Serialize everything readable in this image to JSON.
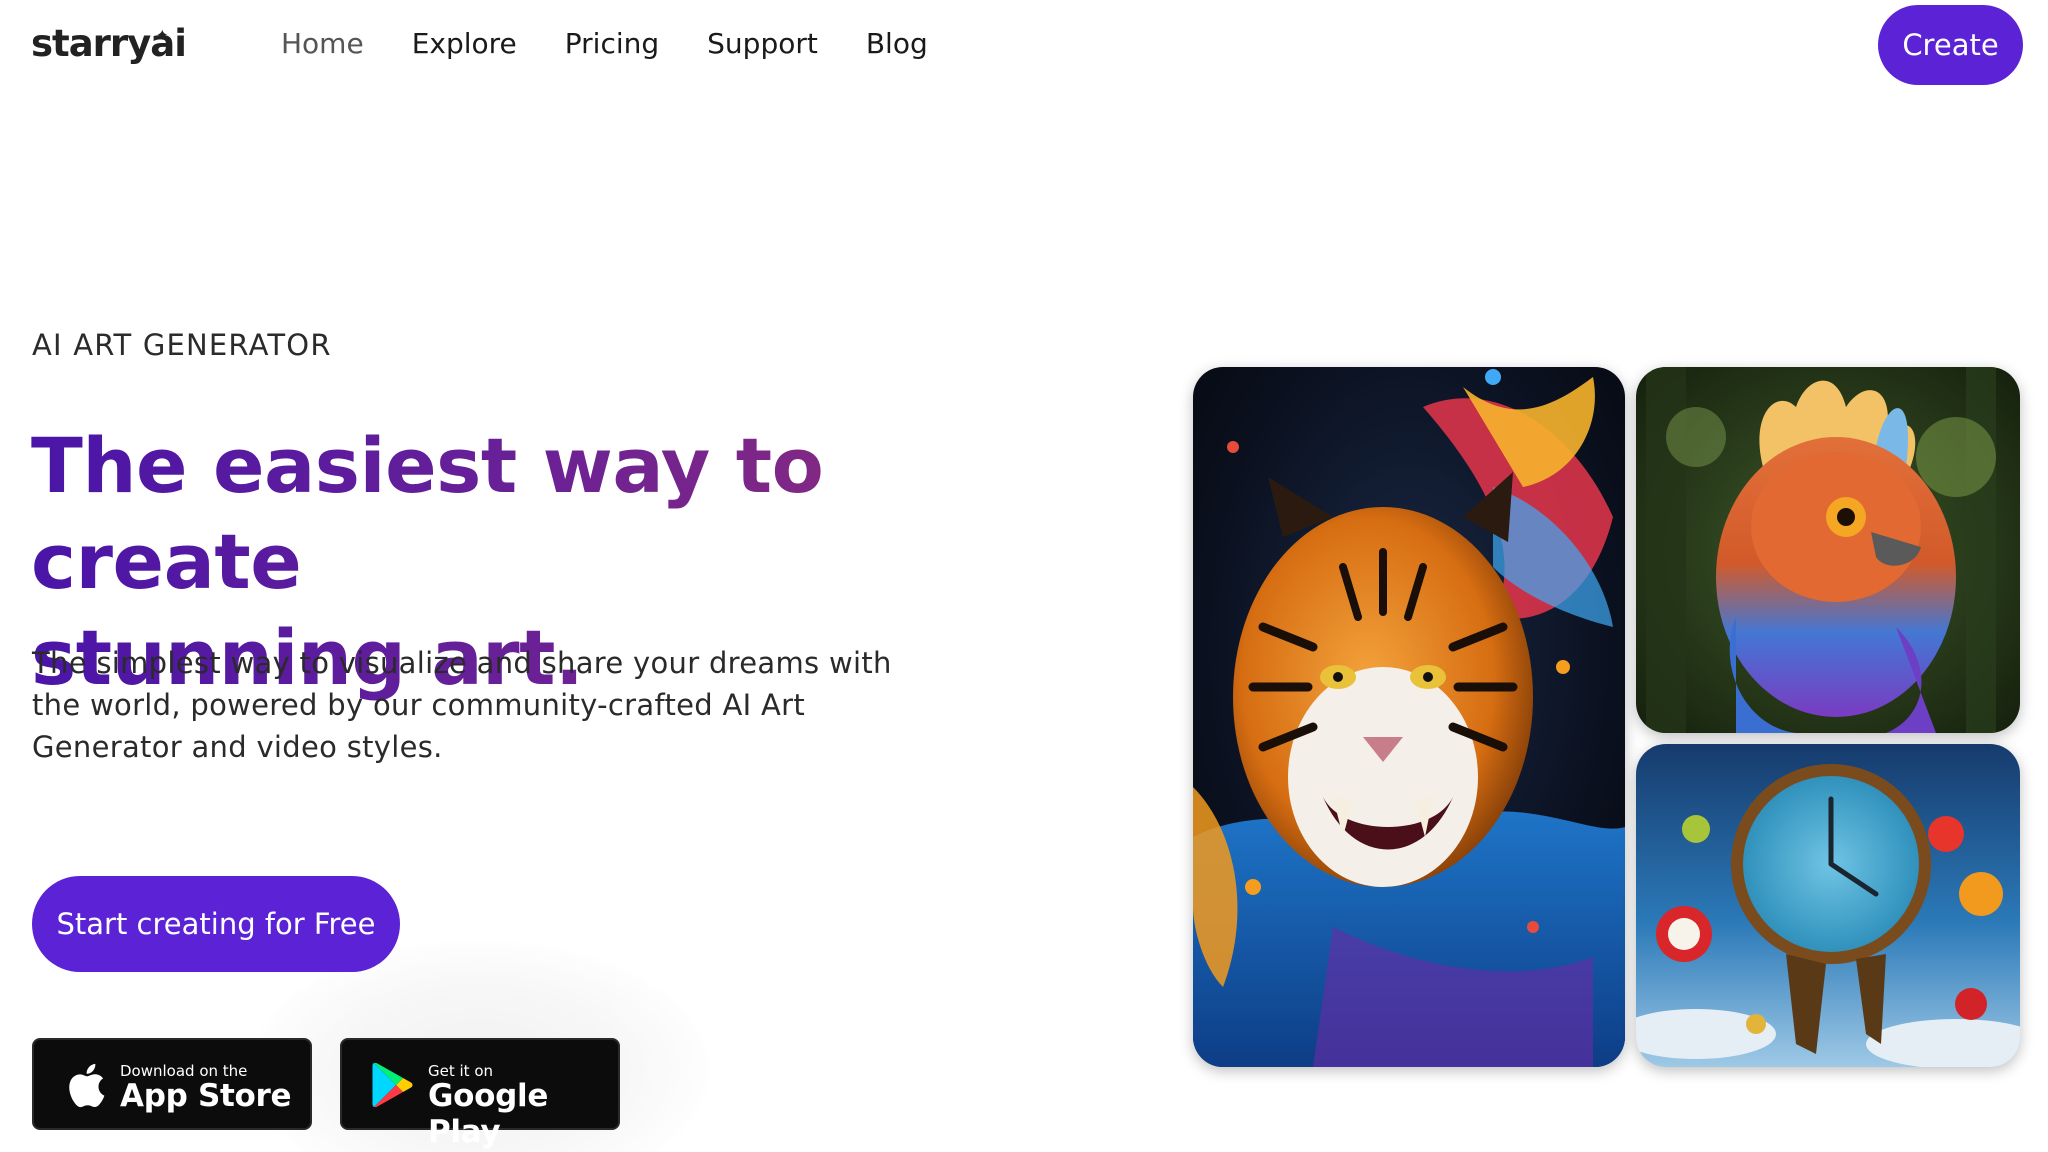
{
  "nav": {
    "logo": "starryai",
    "links": [
      {
        "label": "Home"
      },
      {
        "label": "Explore"
      },
      {
        "label": "Pricing"
      },
      {
        "label": "Support"
      },
      {
        "label": "Blog"
      }
    ],
    "create_label": "Create"
  },
  "hero": {
    "eyebrow": "AI ART GENERATOR",
    "headline_line1": "The easiest way to create",
    "headline_line2": "stunning art.",
    "subtext": "The simplest way to visualize and share your dreams with the world, powered by our community-crafted AI Art Generator and video styles.",
    "cta_label": "Start creating for Free"
  },
  "badges": {
    "app_store": {
      "small": "Download on the",
      "big": "App Store",
      "icon": "apple-icon"
    },
    "google_play": {
      "small": "Get it on",
      "big": "Google Play",
      "icon": "google-play-icon"
    }
  },
  "gallery": {
    "images": [
      "tiger-artwork",
      "bird-artwork",
      "melting-clock-artwork"
    ]
  },
  "colors": {
    "accent": "#5b22d6",
    "headline_start": "#4a15a8",
    "headline_end": "#8c2b7c",
    "badge_bg": "#0c0c0c"
  }
}
